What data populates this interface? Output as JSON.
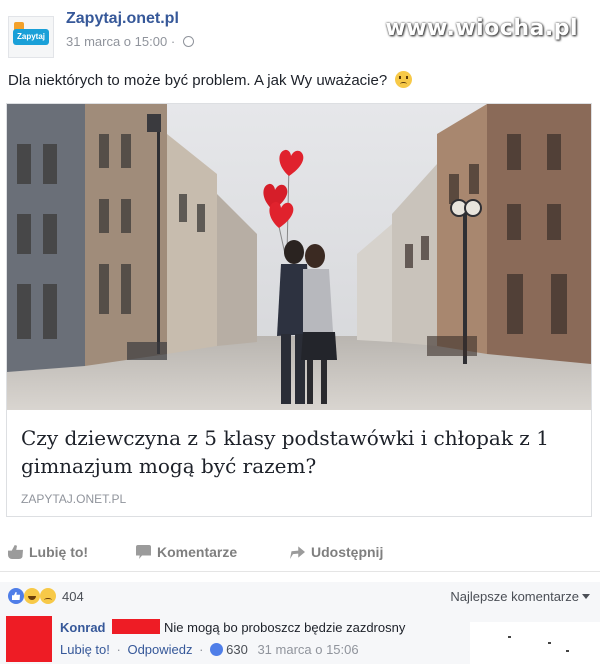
{
  "post": {
    "page_name": "Zapytaj.onet.pl",
    "avatar_text": "Zapytaj",
    "date": "31 marca o 15:00",
    "separator": "·",
    "text": "Dla niektórych to może być problem. A jak Wy uważacie?",
    "watermark": "www.wiocha.pl"
  },
  "link": {
    "title": "Czy dziewczyna z 5 klasy podstawówki i chłopak z 1 gimnazjum mogą być razem?",
    "domain": "ZAPYTAJ.ONET.PL"
  },
  "actions": {
    "like": "Lubię to!",
    "comment": "Komentarze",
    "share": "Udostępnij"
  },
  "reactions": {
    "count": "404",
    "sort": "Najlepsze komentarze"
  },
  "comment": {
    "author": "Konrad",
    "text": "Nie mogą bo proboszcz będzie zazdrosny",
    "like": "Lubię to!",
    "reply": "Odpowiedz",
    "separator": "·",
    "likes": "630",
    "time": "31 marca o 15:06"
  },
  "colors": {
    "link_blue": "#365899",
    "redaction_red": "#ee1c25",
    "meta_gray": "#90949c"
  }
}
